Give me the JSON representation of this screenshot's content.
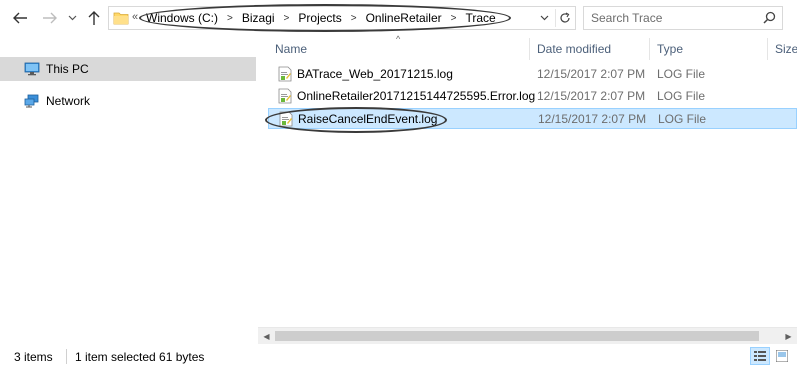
{
  "address": {
    "chevrons": "«",
    "crumbs": [
      "Windows (C:)",
      "Bizagi",
      "Projects",
      "OnlineRetailer",
      "Trace"
    ]
  },
  "search": {
    "placeholder": "Search Trace"
  },
  "nav_pane": {
    "items": [
      {
        "label": "This PC",
        "icon": "computer-icon",
        "selected": true
      },
      {
        "label": "Network",
        "icon": "network-icon",
        "selected": false
      }
    ]
  },
  "columns": {
    "name": "Name",
    "date": "Date modified",
    "type": "Type",
    "size": "Size"
  },
  "files": [
    {
      "name": "BATrace_Web_20171215.log",
      "date": "12/15/2017 2:07 PM",
      "type": "LOG File",
      "selected": false
    },
    {
      "name": "OnlineRetailer20171215144725595.Error.log",
      "date": "12/15/2017 2:07 PM",
      "type": "LOG File",
      "selected": false
    },
    {
      "name": "RaiseCancelEndEvent.log",
      "date": "12/15/2017 2:07 PM",
      "type": "LOG File",
      "selected": true
    }
  ],
  "status": {
    "count": "3 items",
    "selected": "1 item selected  61 bytes"
  },
  "colors": {
    "selection": "#cce8ff",
    "selection_border": "#99d1ff",
    "header_text": "#4c607a",
    "nav_selected": "#d9d9d9"
  }
}
